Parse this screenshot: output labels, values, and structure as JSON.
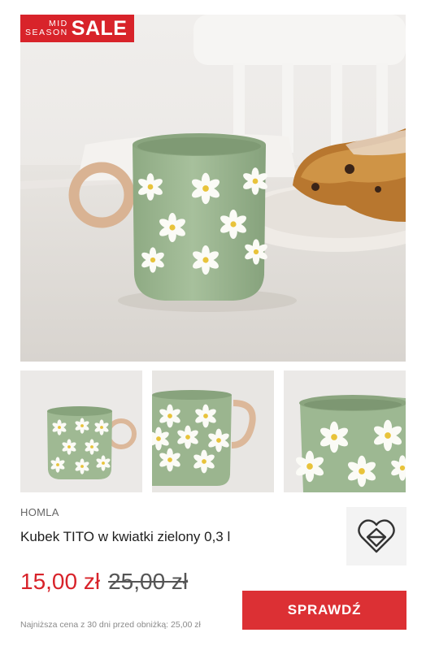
{
  "badge": {
    "small_line_1": "MID",
    "small_line_2": "SEASON",
    "big": "SALE",
    "color": "#d8232a"
  },
  "images": {
    "main_alt": "Kubek TITO w kwiatki zielony 0,3 l",
    "thumbnails": [
      "thumbnail-1",
      "thumbnail-2",
      "thumbnail-3"
    ]
  },
  "product": {
    "brand": "HOMLA",
    "title": "Kubek TITO w kwiatki zielony 0,3 l",
    "price_current": "15,00 zł",
    "price_old": "25,00 zł",
    "cta_label": "SPRAWDŹ",
    "lowest_price_note": "Najniższa cena z 30 dni przed obniżką: 25,00 zł"
  },
  "colors": {
    "accent": "#d8232a",
    "cta": "#dc3034",
    "mug_green": "#9bb68f"
  },
  "icons": {
    "brand_logo": "heart-house-logo-icon"
  }
}
